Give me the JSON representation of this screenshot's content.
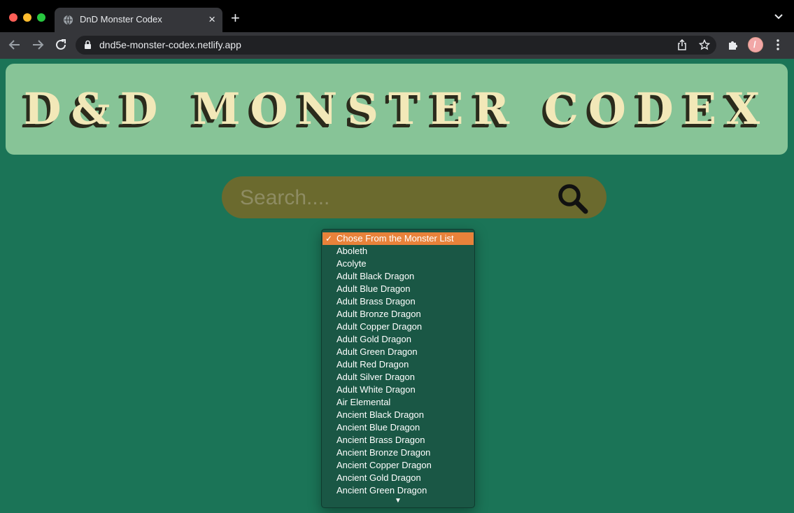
{
  "browser": {
    "tab_title": "DnD Monster Codex",
    "tab_close": "×",
    "new_tab": "+",
    "url": "dnd5e-monster-codex.netlify.app"
  },
  "header": {
    "title": "D&D MONSTER CODEX"
  },
  "search": {
    "placeholder": "Search...."
  },
  "monster_select": {
    "selected_label": "Chose From the Monster List",
    "check_mark": "✓",
    "options": [
      "Aboleth",
      "Acolyte",
      "Adult Black Dragon",
      "Adult Blue Dragon",
      "Adult Brass Dragon",
      "Adult Bronze Dragon",
      "Adult Copper Dragon",
      "Adult Gold Dragon",
      "Adult Green Dragon",
      "Adult Red Dragon",
      "Adult Silver Dragon",
      "Adult White Dragon",
      "Air Elemental",
      "Ancient Black Dragon",
      "Ancient Blue Dragon",
      "Ancient Brass Dragon",
      "Ancient Bronze Dragon",
      "Ancient Copper Dragon",
      "Ancient Gold Dragon",
      "Ancient Green Dragon"
    ],
    "scroll_down": "▼"
  },
  "colors": {
    "page_background": "#1b7457",
    "banner_background": "#87c497",
    "title_color": "#f2e8b8",
    "search_background": "#6b6a2e",
    "dropdown_background": "#1a5745",
    "selected_option": "#e8823a"
  }
}
